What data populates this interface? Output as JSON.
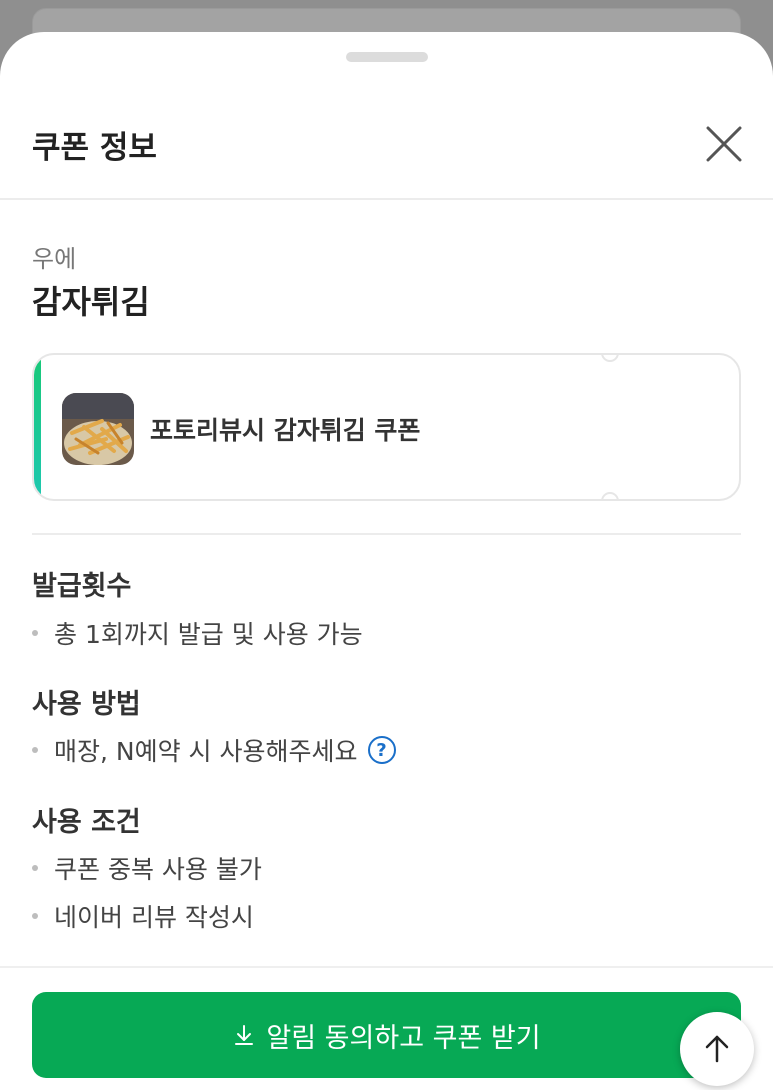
{
  "sheet": {
    "title": "쿠폰 정보",
    "store": "우에",
    "item": "감자튀김"
  },
  "coupon": {
    "title": "포토리뷰시 감자튀김 쿠폰",
    "image_icon": "french-fries-photo",
    "accent_color": "#18c878"
  },
  "sections": [
    {
      "heading": "발급횟수",
      "bullets": [
        "총 1회까지 발급 및 사용 가능"
      ]
    },
    {
      "heading": "사용 방법",
      "bullets": [
        "매장, N예약 시 사용해주세요"
      ]
    },
    {
      "heading": "사용 조건",
      "bullets": [
        "쿠폰 중복 사용 불가",
        "네이버 리뷰 작성시"
      ]
    }
  ],
  "cta": {
    "label": "알림 동의하고 쿠폰 받기",
    "color": "#07a955"
  },
  "icons": {
    "close": "close-icon",
    "help": "question-icon",
    "download": "download-icon",
    "scroll_top": "arrow-up-icon"
  },
  "help_glyph": "?"
}
